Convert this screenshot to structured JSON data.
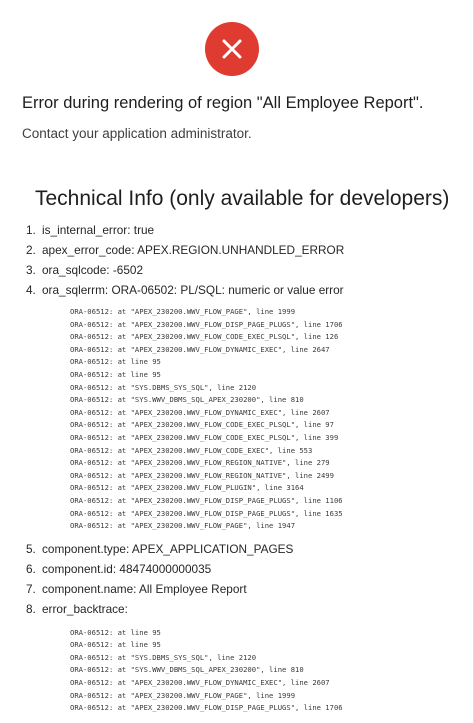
{
  "error": {
    "title": "Error during rendering of region \"All Employee Report\".",
    "message": "Contact your application administrator."
  },
  "technical_info": {
    "heading": "Technical Info (only available for developers)",
    "items": [
      {
        "num": "1.",
        "text": "is_internal_error: true"
      },
      {
        "num": "2.",
        "text": "apex_error_code: APEX.REGION.UNHANDLED_ERROR"
      },
      {
        "num": "3.",
        "text": "ora_sqlcode: -6502"
      },
      {
        "num": "4.",
        "text": "ora_sqlerrm: ORA-06502: PL/SQL: numeric or value error"
      },
      {
        "num": "5.",
        "text": "component.type: APEX_APPLICATION_PAGES"
      },
      {
        "num": "6.",
        "text": "component.id: 48474000000035"
      },
      {
        "num": "7.",
        "text": "component.name: All Employee Report"
      },
      {
        "num": "8.",
        "text": "error_backtrace:"
      }
    ],
    "sqlerrm_stack": [
      "ORA-06512: at \"APEX_230200.WWV_FLOW_PAGE\", line 1999",
      "ORA-06512: at \"APEX_230200.WWV_FLOW_DISP_PAGE_PLUGS\", line 1706",
      "ORA-06512: at \"APEX_230200.WWV_FLOW_CODE_EXEC_PLSQL\", line 126",
      "ORA-06512: at \"APEX_230200.WWV_FLOW_DYNAMIC_EXEC\", line 2647",
      "ORA-06512: at line 95",
      "ORA-06512: at line 95",
      "ORA-06512: at \"SYS.DBMS_SYS_SQL\", line 2120",
      "ORA-06512: at \"SYS.WWV_DBMS_SQL_APEX_230200\", line 810",
      "ORA-06512: at \"APEX_230200.WWV_FLOW_DYNAMIC_EXEC\", line 2607",
      "ORA-06512: at \"APEX_230200.WWV_FLOW_CODE_EXEC_PLSQL\", line 97",
      "ORA-06512: at \"APEX_230200.WWV_FLOW_CODE_EXEC_PLSQL\", line 399",
      "ORA-06512: at \"APEX_230200.WWV_FLOW_CODE_EXEC\", line 553",
      "ORA-06512: at \"APEX_230200.WWV_FLOW_REGION_NATIVE\", line 279",
      "ORA-06512: at \"APEX_230200.WWV_FLOW_REGION_NATIVE\", line 2499",
      "ORA-06512: at \"APEX_230200.WWV_FLOW_PLUGIN\", line 3164",
      "ORA-06512: at \"APEX_230200.WWV_FLOW_DISP_PAGE_PLUGS\", line 1106",
      "ORA-06512: at \"APEX_230200.WWV_FLOW_DISP_PAGE_PLUGS\", line 1635",
      "ORA-06512: at \"APEX_230200.WWV_FLOW_PAGE\", line 1947"
    ],
    "backtrace_stack": [
      "ORA-06512: at line 95",
      "ORA-06512: at line 95",
      "ORA-06512: at \"SYS.DBMS_SYS_SQL\", line 2120",
      "ORA-06512: at \"SYS.WWV_DBMS_SQL_APEX_230200\", line 810",
      "ORA-06512: at \"APEX_230200.WWV_FLOW_DYNAMIC_EXEC\", line 2607",
      "ORA-06512: at \"APEX_230200.WWV_FLOW_PAGE\", line 1999",
      "ORA-06512: at \"APEX_230200.WWV_FLOW_DISP_PAGE_PLUGS\", line 1706"
    ]
  },
  "icon": {
    "name": "close-icon",
    "color": "#e03b30"
  }
}
